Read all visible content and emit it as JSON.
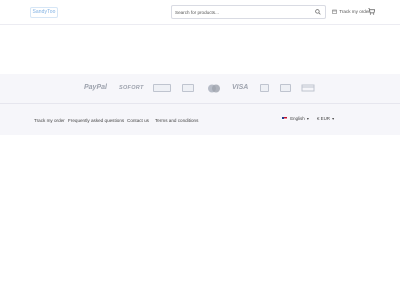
{
  "header": {
    "logo_text": "SandyToo",
    "search_placeholder": "Search for products...",
    "track_order_label": "Track my order"
  },
  "payments": [
    "PayPal",
    "SOFORT"
  ],
  "footer": {
    "links": [
      "Track my order",
      "Frequently asked questions",
      "Contact us",
      "Terms and conditions"
    ],
    "language": "English",
    "currency": "€ EUR"
  },
  "icons": {
    "search": "search-icon",
    "cart": "cart-icon",
    "track": "box-icon",
    "flag": "uk-flag-icon",
    "chevron": "chevron-down-icon"
  },
  "colors": {
    "band_bg": "#f6f6fa",
    "logo": "#7fb0e2",
    "payment_logo": "#9da2ad"
  }
}
